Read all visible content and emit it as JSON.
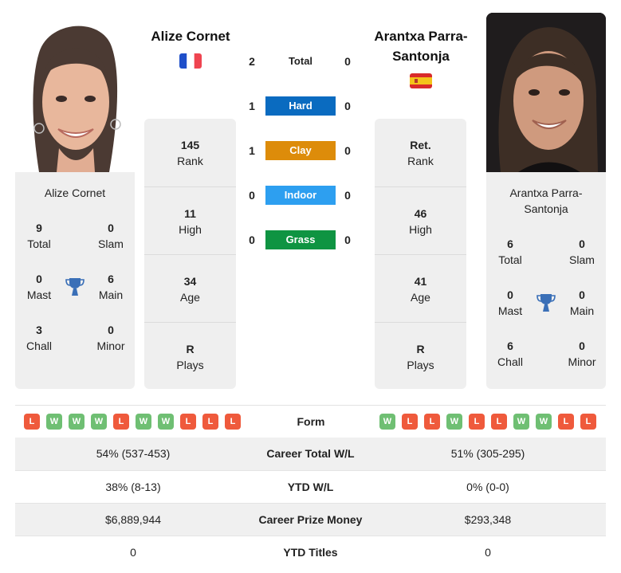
{
  "players": {
    "left": {
      "name": "Alize Cornet",
      "card_name": "Alize Cornet",
      "country": "France",
      "flag_icon": "flag-france",
      "photo_alt": "Alize Cornet photo",
      "titles": {
        "total": {
          "value": "9",
          "label": "Total"
        },
        "slam": {
          "value": "0",
          "label": "Slam"
        },
        "mast": {
          "value": "0",
          "label": "Mast"
        },
        "main": {
          "value": "6",
          "label": "Main"
        },
        "chall": {
          "value": "3",
          "label": "Chall"
        },
        "minor": {
          "value": "0",
          "label": "Minor"
        }
      },
      "info": [
        {
          "value": "145",
          "label": "Rank"
        },
        {
          "value": "11",
          "label": "High"
        },
        {
          "value": "34",
          "label": "Age"
        },
        {
          "value": "R",
          "label": "Plays"
        }
      ],
      "form": [
        "L",
        "W",
        "W",
        "W",
        "L",
        "W",
        "W",
        "L",
        "L",
        "L"
      ]
    },
    "right": {
      "name_line1": "Arantxa Parra-",
      "name_line2": "Santonja",
      "card_name_line1": "Arantxa Parra-",
      "card_name_line2": "Santonja",
      "country": "Spain",
      "flag_icon": "flag-spain",
      "photo_alt": "Arantxa Parra-Santonja photo",
      "titles": {
        "total": {
          "value": "6",
          "label": "Total"
        },
        "slam": {
          "value": "0",
          "label": "Slam"
        },
        "mast": {
          "value": "0",
          "label": "Mast"
        },
        "main": {
          "value": "0",
          "label": "Main"
        },
        "chall": {
          "value": "6",
          "label": "Chall"
        },
        "minor": {
          "value": "0",
          "label": "Minor"
        }
      },
      "info": [
        {
          "value": "Ret.",
          "label": "Rank"
        },
        {
          "value": "46",
          "label": "High"
        },
        {
          "value": "41",
          "label": "Age"
        },
        {
          "value": "R",
          "label": "Plays"
        }
      ],
      "form": [
        "W",
        "L",
        "L",
        "W",
        "L",
        "L",
        "W",
        "W",
        "L",
        "L"
      ]
    }
  },
  "h2h": [
    {
      "label": "Total",
      "left": "2",
      "right": "0",
      "color": null
    },
    {
      "label": "Hard",
      "left": "1",
      "right": "0",
      "color": "#0a6bc0"
    },
    {
      "label": "Clay",
      "left": "1",
      "right": "0",
      "color": "#dd8c0a"
    },
    {
      "label": "Indoor",
      "left": "0",
      "right": "0",
      "color": "#2d9ff0"
    },
    {
      "label": "Grass",
      "left": "0",
      "right": "0",
      "color": "#0f9442"
    }
  ],
  "form_label": "Form",
  "comparison": [
    {
      "label": "Career Total W/L",
      "left": "54% (537-453)",
      "right": "51% (305-295)"
    },
    {
      "label": "YTD W/L",
      "left": "38% (8-13)",
      "right": "0% (0-0)"
    },
    {
      "label": "Career Prize Money",
      "left": "$6,889,944",
      "right": "$293,348"
    },
    {
      "label": "YTD Titles",
      "left": "0",
      "right": "0"
    }
  ],
  "colors": {
    "win": "#6fbf73",
    "loss": "#ef5a3c",
    "trophy": "#3a6fb7",
    "card_bg": "#efefef"
  }
}
